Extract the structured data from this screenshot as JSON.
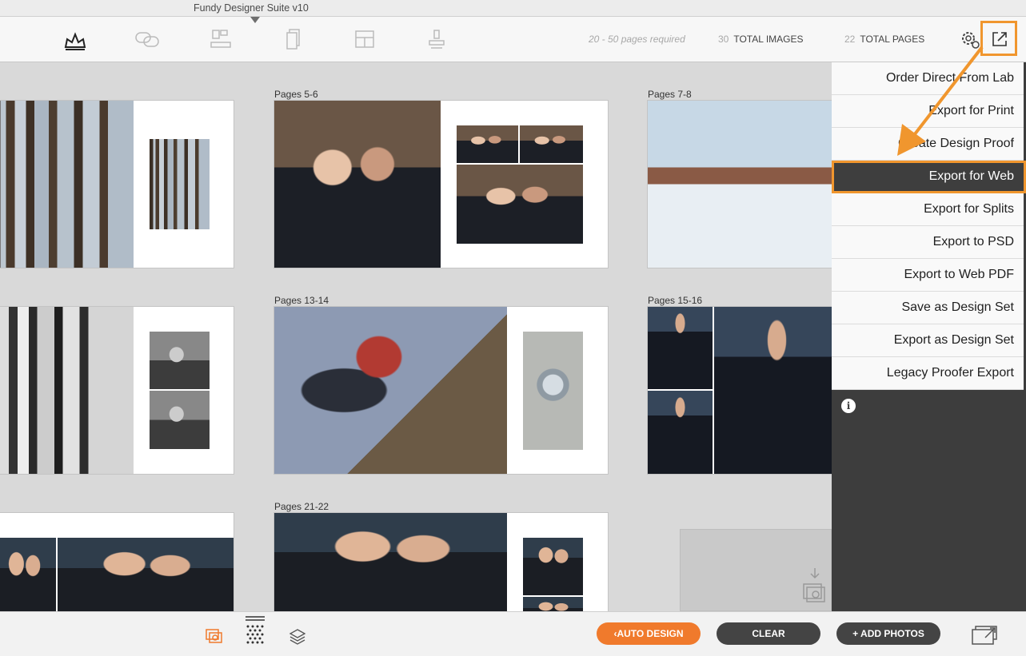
{
  "window": {
    "title": "Fundy Designer Suite v10"
  },
  "toolbar": {
    "tabs": [
      {
        "name": "album-icon"
      },
      {
        "name": "chat-icon"
      },
      {
        "name": "wall-art-icon"
      },
      {
        "name": "cards-icon"
      },
      {
        "name": "layout-icon"
      },
      {
        "name": "stamp-icon"
      }
    ],
    "pages_required": "20 - 50 pages required",
    "total_images_count": "30",
    "total_images_label": "TOTAL IMAGES",
    "total_pages_count": "22",
    "total_pages_label": "TOTAL PAGES"
  },
  "spreads": [
    {
      "label": ""
    },
    {
      "label": "Pages 5-6"
    },
    {
      "label": "Pages 7-8"
    },
    {
      "label": ""
    },
    {
      "label": "Pages 13-14"
    },
    {
      "label": "Pages 15-16"
    },
    {
      "label": ""
    },
    {
      "label": "Pages 21-22"
    }
  ],
  "menu": {
    "items": [
      "Order Direct From Lab",
      "Export for Print",
      "Create Design Proof",
      "Export for Web",
      "Export for Splits",
      "Export to PSD",
      "Export to Web PDF",
      "Save as Design Set",
      "Export as Design Set",
      "Legacy Proofer Export"
    ],
    "active_index": 3,
    "info_glyph": "i"
  },
  "bottombar": {
    "auto_design": "AUTO DESIGN",
    "clear": "CLEAR",
    "add_photos": "+ ADD PHOTOS"
  },
  "colors": {
    "accent": "#f07a2c",
    "highlight": "#f0962e",
    "dark": "#3d3d3d"
  }
}
